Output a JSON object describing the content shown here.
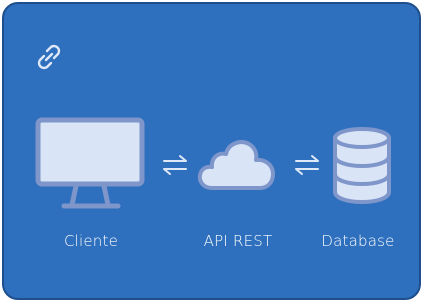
{
  "colors": {
    "card_background": "#2e6fbe",
    "card_border": "#1e4f8c",
    "icon_fill": "#d9e4f7",
    "icon_stroke": "#7f96ca",
    "arrow": "#dfe8f8",
    "label_text": "#ffffff"
  },
  "icons": {
    "top_left": "link-icon",
    "connector": "bidirectional-arrows-icon"
  },
  "nodes": [
    {
      "label": "Cliente",
      "icon": "monitor-icon"
    },
    {
      "label": "API REST",
      "icon": "cloud-icon"
    },
    {
      "label": "Database",
      "icon": "database-icon"
    }
  ]
}
